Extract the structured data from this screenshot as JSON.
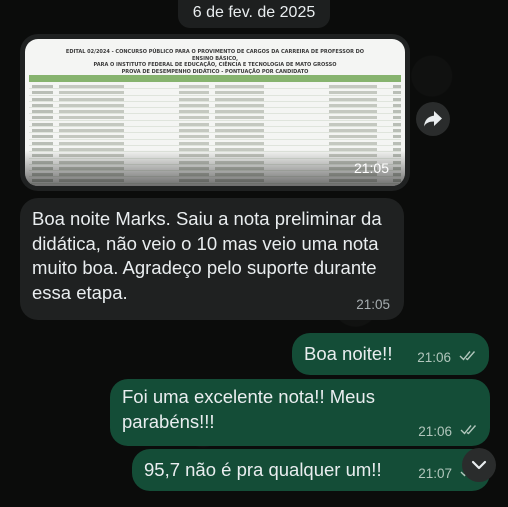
{
  "chat": {
    "date_label": "6 de fev. de 2025",
    "image_message": {
      "doc_header": [
        "EDITAL 02/2024 - CONCURSO PÚBLICO PARA O PROVIMENTO DE CARGOS DA CARREIRA DE PROFESSOR DO ENSINO BÁSICO,",
        "PARA O INSTITUTO FEDERAL DE EDUCAÇÃO, CIÊNCIA E TECNOLOGIA DE MATO GROSSO",
        "PROVA DE DESEMPENHO DIDÁTICO - PONTUAÇÃO POR CANDIDATO"
      ],
      "row_count": 16,
      "time": "21:05"
    },
    "incoming_text": {
      "text": "Boa noite Marks. Saiu a nota preliminar da didática, não veio o 10 mas veio uma nota muito boa. Agradeço pelo suporte durante essa etapa.",
      "time": "21:05"
    },
    "outgoing": [
      {
        "text": "Boa noite!!",
        "time": "21:06",
        "status": "read"
      },
      {
        "text": "Foi uma excelente nota!! Meus parabéns!!!",
        "time": "21:06",
        "status": "read"
      },
      {
        "text": "95,7 não é pra qualquer um!!",
        "time": "21:07",
        "status": "read"
      }
    ],
    "icons": {
      "forward": "forward-arrow-icon",
      "scroll_down": "chevron-down-icon",
      "read_receipt": "double-check-icon"
    },
    "colors": {
      "background": "#0b0c0b",
      "incoming_bubble": "#1f2121",
      "outgoing_bubble": "#144d37",
      "read_tick": "#b1c6bc"
    }
  }
}
